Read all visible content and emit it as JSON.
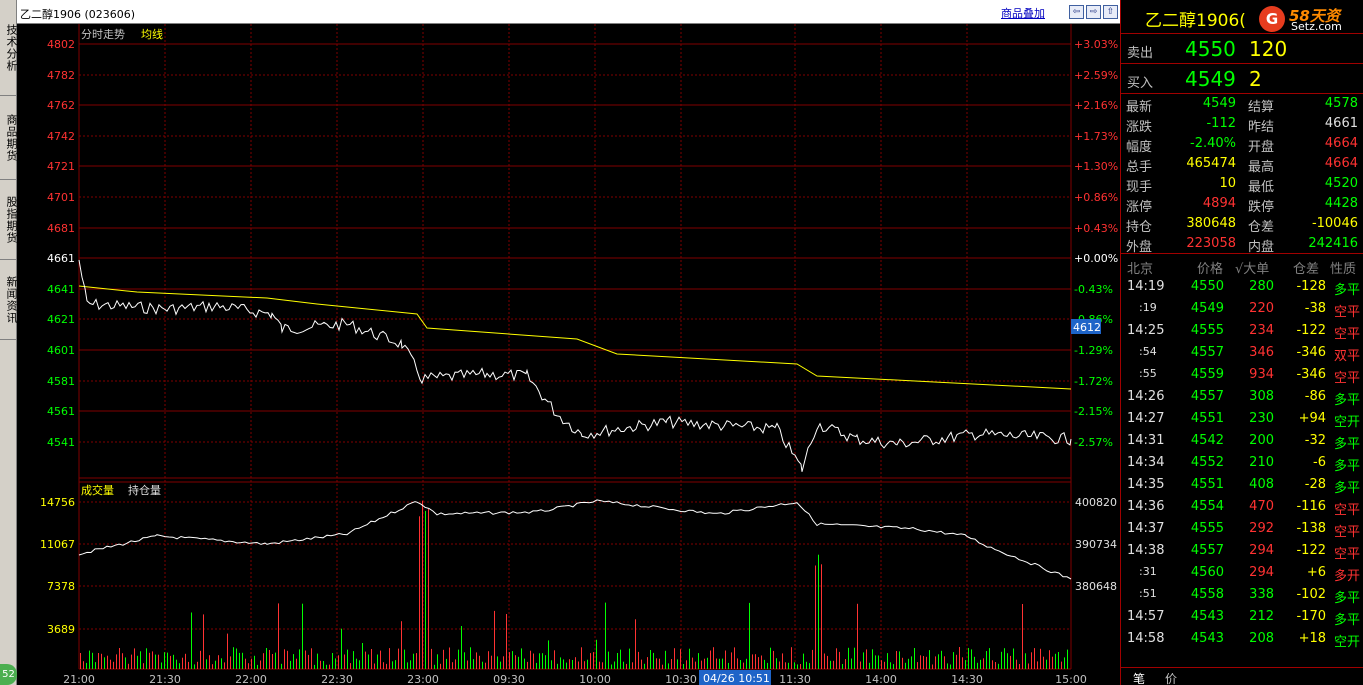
{
  "side_tabs": [
    "技术分析",
    "商品期货",
    "股指期货",
    "新闻资讯"
  ],
  "side_badge": "52",
  "header": {
    "symbol_code": "乙二醇1906 (023606)",
    "overlay_link": "商品叠加",
    "buttons": [
      "⇦",
      "⇨",
      "⇧"
    ]
  },
  "chart": {
    "tab_label": "分时走势",
    "avg_label": "均线",
    "volume_label": "成交量",
    "oi_label": "持仓量",
    "price_ticks": [
      "4802",
      "4782",
      "4762",
      "4742",
      "4721",
      "4701",
      "4681",
      "4661",
      "4641",
      "4621",
      "4601",
      "4581",
      "4561",
      "4541"
    ],
    "pct_ticks": [
      "+3.03%",
      "+2.59%",
      "+2.16%",
      "+1.73%",
      "+1.30%",
      "+0.86%",
      "+0.43%",
      "+0.00%",
      "-0.43%",
      "-0.86%",
      "-1.29%",
      "-1.72%",
      "-2.15%",
      "-2.57%"
    ],
    "current_price_tag": "4612",
    "volume_ticks": [
      "14756",
      "11067",
      "7378",
      "3689"
    ],
    "oi_ticks": [
      "400820",
      "390734",
      "380648"
    ],
    "time_ticks": [
      "21:00",
      "21:30",
      "22:00",
      "22:30",
      "23:00",
      "09:30",
      "10:00",
      "10:30",
      "11:30",
      "14:00",
      "14:30",
      "15:00"
    ],
    "cursor_time": "04/26 10:51",
    "colors": {
      "grid": "#800000",
      "price_line": "#ffffff",
      "avg_line": "#ffff00",
      "up_label": "#ff3232",
      "down_label": "#00ff00"
    }
  },
  "panel": {
    "title": "乙二醇1906(",
    "logo_mark": "G",
    "logo_brand": "58天资",
    "logo_url": "Setz.com",
    "ask": {
      "label": "卖出",
      "price": "4550",
      "volume": "120"
    },
    "bid": {
      "label": "买入",
      "price": "4549",
      "volume": "2"
    },
    "stats": [
      {
        "l1": "最新",
        "v1": "4549",
        "c1": "#00ff00",
        "l2": "结算",
        "v2": "4578",
        "c2": "#00ff00"
      },
      {
        "l1": "涨跌",
        "v1": "-112",
        "c1": "#00ff00",
        "l2": "昨结",
        "v2": "4661",
        "c2": "#e0e0e0"
      },
      {
        "l1": "幅度",
        "v1": "-2.40%",
        "c1": "#00ff00",
        "l2": "开盘",
        "v2": "4664",
        "c2": "#ff3232"
      },
      {
        "l1": "总手",
        "v1": "465474",
        "c1": "#ffff00",
        "l2": "最高",
        "v2": "4664",
        "c2": "#ff3232"
      },
      {
        "l1": "现手",
        "v1": "10",
        "c1": "#ffff00",
        "l2": "最低",
        "v2": "4520",
        "c2": "#00ff00"
      },
      {
        "l1": "涨停",
        "v1": "4894",
        "c1": "#ff3232",
        "l2": "跌停",
        "v2": "4428",
        "c2": "#00ff00"
      },
      {
        "l1": "持仓",
        "v1": "380648",
        "c1": "#ffff00",
        "l2": "仓差",
        "v2": "-10046",
        "c2": "#ffff00"
      },
      {
        "l1": "外盘",
        "v1": "223058",
        "c1": "#ff3232",
        "l2": "内盘",
        "v2": "242416",
        "c2": "#00ff00"
      }
    ],
    "tick_header": {
      "time": "北京",
      "price": "价格",
      "vol": "√大单",
      "oi": "仓差",
      "nature": "性质"
    },
    "ticks": [
      {
        "time": "14:19",
        "price": "4550",
        "vol": "280",
        "vc": "#00ff00",
        "oi": "-128",
        "nature": "多平",
        "nc": "#00ff00"
      },
      {
        "time": ":19",
        "price": "4549",
        "vol": "220",
        "vc": "#ff3232",
        "oi": "-38",
        "nature": "空平",
        "nc": "#ff3232"
      },
      {
        "time": "14:25",
        "price": "4555",
        "vol": "234",
        "vc": "#ff3232",
        "oi": "-122",
        "nature": "空平",
        "nc": "#ff3232"
      },
      {
        "time": ":54",
        "price": "4557",
        "vol": "346",
        "vc": "#ff3232",
        "oi": "-346",
        "nature": "双平",
        "nc": "#ff3232"
      },
      {
        "time": ":55",
        "price": "4559",
        "vol": "934",
        "vc": "#ff3232",
        "oi": "-346",
        "nature": "空平",
        "nc": "#ff3232"
      },
      {
        "time": "14:26",
        "price": "4557",
        "vol": "308",
        "vc": "#00ff00",
        "oi": "-86",
        "nature": "多平",
        "nc": "#00ff00"
      },
      {
        "time": "14:27",
        "price": "4551",
        "vol": "230",
        "vc": "#00ff00",
        "oi": "+94",
        "nature": "空开",
        "nc": "#00ff00"
      },
      {
        "time": "14:31",
        "price": "4542",
        "vol": "200",
        "vc": "#00ff00",
        "oi": "-32",
        "nature": "多平",
        "nc": "#00ff00"
      },
      {
        "time": "14:34",
        "price": "4552",
        "vol": "210",
        "vc": "#00ff00",
        "oi": "-6",
        "nature": "多平",
        "nc": "#00ff00"
      },
      {
        "time": "14:35",
        "price": "4551",
        "vol": "408",
        "vc": "#00ff00",
        "oi": "-28",
        "nature": "多平",
        "nc": "#00ff00"
      },
      {
        "time": "14:36",
        "price": "4554",
        "vol": "470",
        "vc": "#ff3232",
        "oi": "-116",
        "nature": "空平",
        "nc": "#ff3232"
      },
      {
        "time": "14:37",
        "price": "4555",
        "vol": "292",
        "vc": "#ff3232",
        "oi": "-138",
        "nature": "空平",
        "nc": "#ff3232"
      },
      {
        "time": "14:38",
        "price": "4557",
        "vol": "294",
        "vc": "#ff3232",
        "oi": "-122",
        "nature": "空平",
        "nc": "#ff3232"
      },
      {
        "time": ":31",
        "price": "4560",
        "vol": "294",
        "vc": "#ff3232",
        "oi": "+6",
        "nature": "多开",
        "nc": "#ff3232"
      },
      {
        "time": ":51",
        "price": "4558",
        "vol": "338",
        "vc": "#00ff00",
        "oi": "-102",
        "nature": "多平",
        "nc": "#00ff00"
      },
      {
        "time": "14:57",
        "price": "4543",
        "vol": "212",
        "vc": "#00ff00",
        "oi": "-170",
        "nature": "多平",
        "nc": "#00ff00"
      },
      {
        "time": "14:58",
        "price": "4543",
        "vol": "208",
        "vc": "#00ff00",
        "oi": "+18",
        "nature": "空开",
        "nc": "#00ff00"
      }
    ],
    "tabs": [
      "笔",
      "价"
    ]
  },
  "chart_data": {
    "type": "line",
    "series": [],
    "price_range": [
      4541,
      4802
    ],
    "previous_settle": 4661,
    "grid": true
  }
}
